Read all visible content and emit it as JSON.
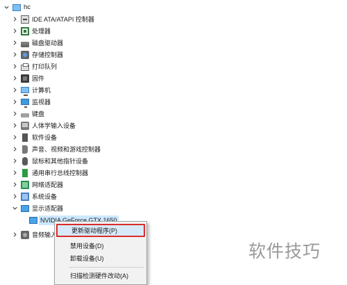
{
  "tree": {
    "root": {
      "label": "hc",
      "icon": "computer-icon"
    },
    "categories": [
      {
        "label": "IDE ATA/ATAPI 控制器",
        "icon": "ide-controller-icon",
        "expanded": false
      },
      {
        "label": "处理器",
        "icon": "processor-icon",
        "expanded": false
      },
      {
        "label": "磁盘驱动器",
        "icon": "disk-drive-icon",
        "expanded": false
      },
      {
        "label": "存储控制器",
        "icon": "storage-controller-icon",
        "expanded": false
      },
      {
        "label": "打印队列",
        "icon": "printer-icon",
        "expanded": false
      },
      {
        "label": "固件",
        "icon": "firmware-icon",
        "expanded": false
      },
      {
        "label": "计算机",
        "icon": "computer-icon",
        "expanded": false
      },
      {
        "label": "监视器",
        "icon": "monitor-icon",
        "expanded": false
      },
      {
        "label": "键盘",
        "icon": "keyboard-icon",
        "expanded": false
      },
      {
        "label": "人体学输入设备",
        "icon": "hid-icon",
        "expanded": false
      },
      {
        "label": "软件设备",
        "icon": "software-device-icon",
        "expanded": false
      },
      {
        "label": "声音、视频和游戏控制器",
        "icon": "sound-icon",
        "expanded": false
      },
      {
        "label": "鼠标和其他指针设备",
        "icon": "mouse-icon",
        "expanded": false
      },
      {
        "label": "通用串行总线控制器",
        "icon": "usb-icon",
        "expanded": false
      },
      {
        "label": "网络适配器",
        "icon": "network-adapter-icon",
        "expanded": false
      },
      {
        "label": "系统设备",
        "icon": "system-device-icon",
        "expanded": false
      },
      {
        "label": "显示适配器",
        "icon": "display-adapter-icon",
        "expanded": true
      },
      {
        "label": "音频输入和",
        "icon": "audio-io-icon",
        "expanded": false
      }
    ],
    "display_child": {
      "label": "NVIDIA GeForce GTX 1650",
      "icon": "gpu-icon"
    }
  },
  "context_menu": {
    "items": [
      {
        "label": "更新驱动程序(P)",
        "highlighted": true
      },
      {
        "label": "禁用设备(D)",
        "highlighted": false
      },
      {
        "label": "卸载设备(U)",
        "highlighted": false
      },
      {
        "label": "扫描检测硬件改动(A)",
        "highlighted": false
      }
    ],
    "highlight_border": "#d92b2b"
  },
  "watermark": {
    "text": "软件技巧"
  }
}
